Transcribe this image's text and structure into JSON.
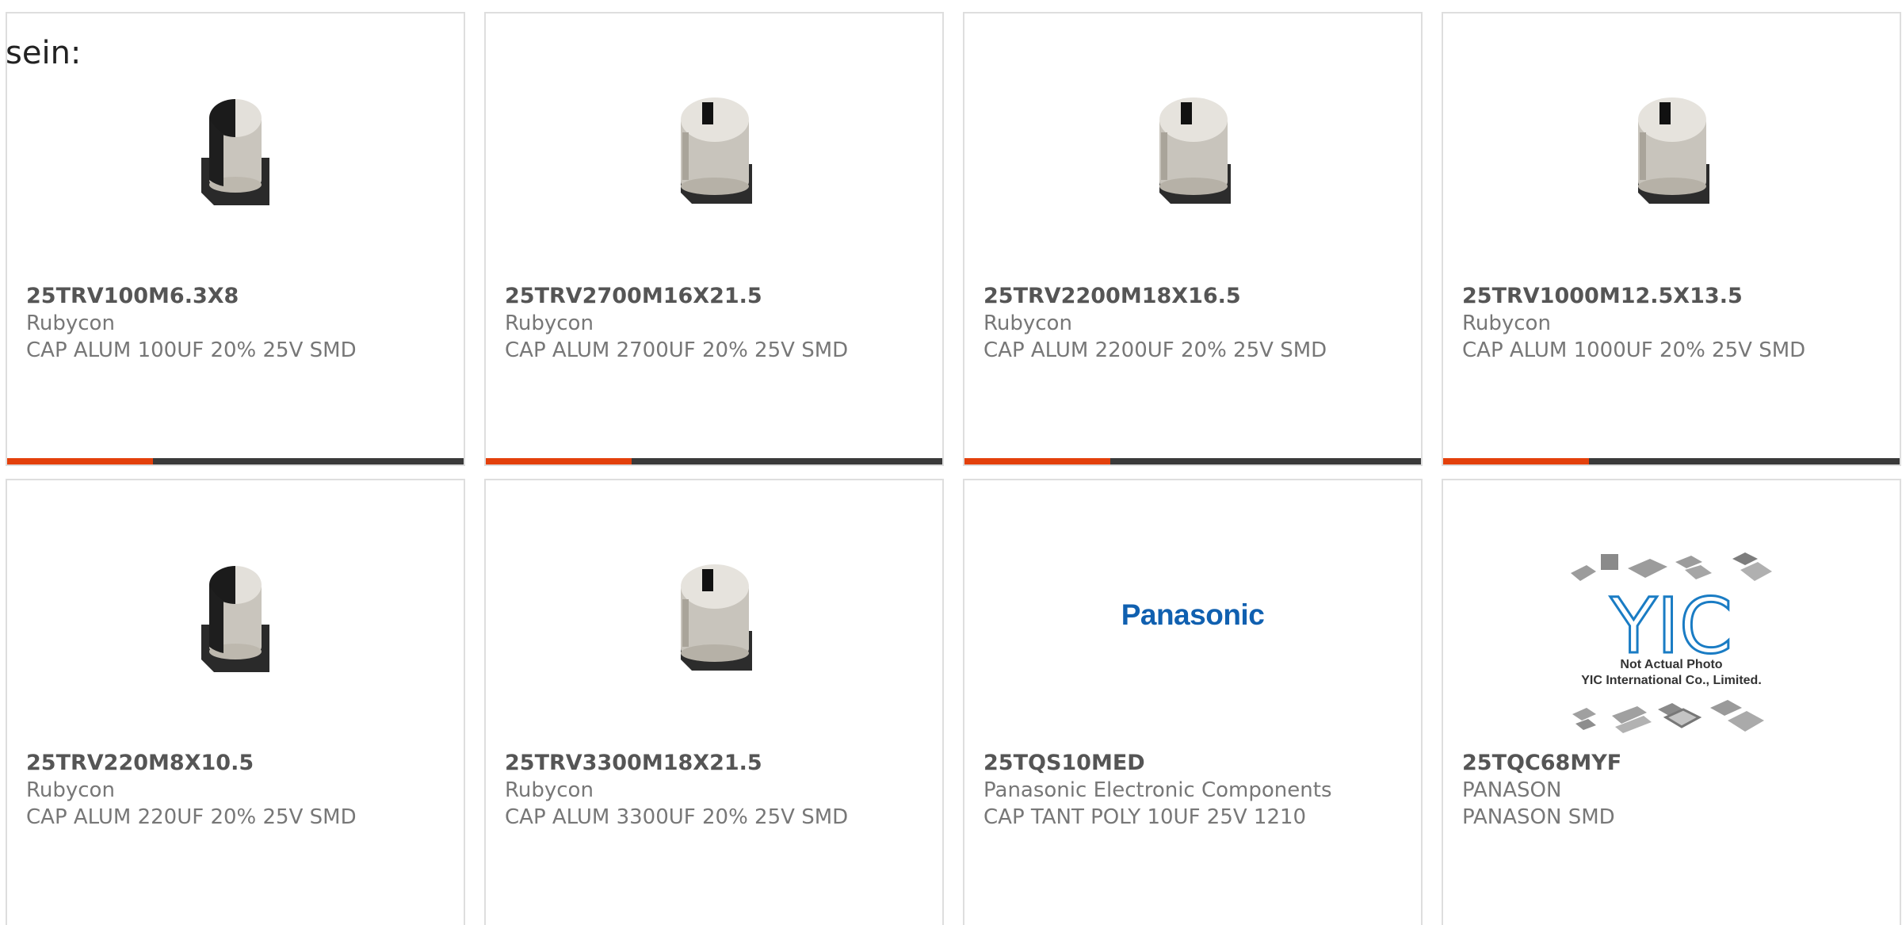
{
  "heading": "sein:",
  "colors": {
    "accent": "#e3400b",
    "bar": "#3a3a3a",
    "border": "#dedede",
    "panasonic_blue": "#1060b0",
    "yic_blue": "#1a7cc4"
  },
  "products": [
    {
      "part": "25TRV100M6.3X8",
      "mfr": "Rubycon",
      "desc": "CAP ALUM 100UF 20% 25V SMD",
      "image": "capacitor-half-stripe",
      "progress_pct": 32
    },
    {
      "part": "25TRV2700M16X21.5",
      "mfr": "Rubycon",
      "desc": "CAP ALUM 2700UF 20% 25V SMD",
      "image": "capacitor-mark",
      "progress_pct": 32
    },
    {
      "part": "25TRV2200M18X16.5",
      "mfr": "Rubycon",
      "desc": "CAP ALUM 2200UF 20% 25V SMD",
      "image": "capacitor-mark",
      "progress_pct": 32
    },
    {
      "part": "25TRV1000M12.5X13.5",
      "mfr": "Rubycon",
      "desc": "CAP ALUM 1000UF 20% 25V SMD",
      "image": "capacitor-mark",
      "progress_pct": 32
    },
    {
      "part": "25TRV220M8X10.5",
      "mfr": "Rubycon",
      "desc": "CAP ALUM 220UF 20% 25V SMD",
      "image": "capacitor-half-stripe"
    },
    {
      "part": "25TRV3300M18X21.5",
      "mfr": "Rubycon",
      "desc": "CAP ALUM 3300UF 20% 25V SMD",
      "image": "capacitor-mark"
    },
    {
      "part": "25TQS10MED",
      "mfr": "Panasonic Electronic Components",
      "desc": "CAP TANT POLY 10UF 25V 1210",
      "image": "panasonic-logo",
      "logo_text": "Panasonic"
    },
    {
      "part": "25TQC68MYF",
      "mfr": "PANASON",
      "desc": "PANASON SMD",
      "image": "yic-placeholder",
      "logo_text": "YIC",
      "caption_1": "Not Actual Photo",
      "caption_2": "YIC International Co., Limited."
    }
  ]
}
